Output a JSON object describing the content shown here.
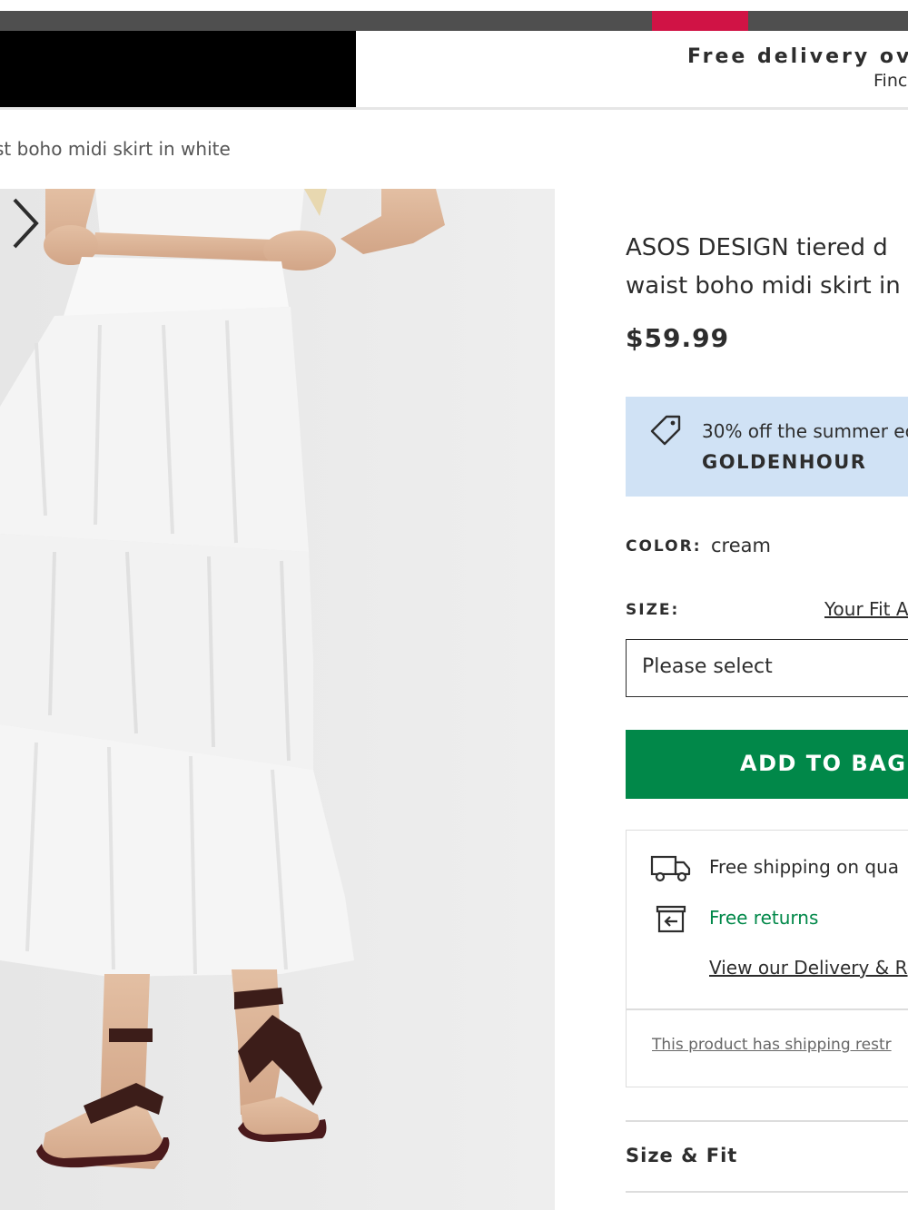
{
  "top_banner": {
    "delivery_title": "Free delivery ove",
    "delivery_subtitle": "Finc"
  },
  "breadcrumb": {
    "current": "st boho midi skirt in white"
  },
  "gallery": {
    "image_alt": "Model wearing white tiered midi skirt with crop top and dark brown sandals",
    "next_icon": "chevron-right-icon"
  },
  "product": {
    "title_line1": "ASOS DESIGN tiered d",
    "title_line2": "waist boho midi skirt in v",
    "price": "$59.99"
  },
  "promo": {
    "icon": "tag-icon",
    "text": "30% off the summer ec",
    "code": "GOLDENHOUR",
    "background": "#d0e2f5"
  },
  "color": {
    "label": "COLOR:",
    "value": "cream"
  },
  "size": {
    "label": "SIZE:",
    "fit_link": "Your Fit A",
    "placeholder": "Please select"
  },
  "add_to_bag": {
    "label": "ADD TO BAG",
    "color": "#018849"
  },
  "shipping": {
    "truck_icon": "truck-icon",
    "shipping_text": "Free shipping on qua",
    "returns_icon": "returns-box-icon",
    "returns_text": "Free returns",
    "policy_link": "View our Delivery & R",
    "restriction_link": "This product has shipping restr"
  },
  "accordion": {
    "size_fit": "Size & Fit"
  },
  "colors": {
    "accent_red": "#d01345",
    "green": "#018849",
    "text": "#2d2d2d"
  }
}
